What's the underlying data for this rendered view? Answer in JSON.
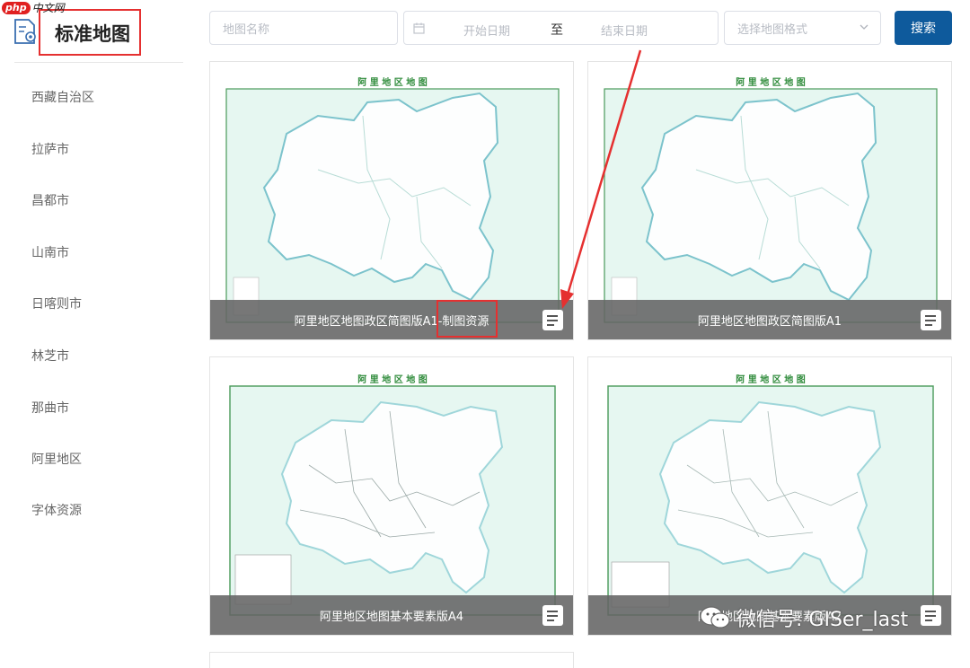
{
  "watermark_top": {
    "badge": "php",
    "text": "中文网"
  },
  "sidebar": {
    "title": "标准地图",
    "items": [
      {
        "label": "西藏自治区"
      },
      {
        "label": "拉萨市"
      },
      {
        "label": "昌都市"
      },
      {
        "label": "山南市"
      },
      {
        "label": "日喀则市"
      },
      {
        "label": "林芝市"
      },
      {
        "label": "那曲市"
      },
      {
        "label": "阿里地区"
      },
      {
        "label": "字体资源"
      }
    ]
  },
  "search": {
    "name_placeholder": "地图名称",
    "start_placeholder": "开始日期",
    "range_separator": "至",
    "end_placeholder": "结束日期",
    "format_placeholder": "选择地图格式",
    "button_label": "搜索"
  },
  "cards": [
    {
      "caption": "阿里地区地图政区简图版A1-制图资源",
      "map_title": "阿 里 地 区 地 图"
    },
    {
      "caption": "阿里地区地图政区简图版A1",
      "map_title": "阿 里 地 区 地 图"
    },
    {
      "caption": "阿里地区地图基本要素版A4",
      "map_title": "阿 里 地 区 地 图"
    },
    {
      "caption": "阿里地区地图基本要素版A2",
      "map_title": "阿 里 地 区 地 图"
    }
  ],
  "watermark_bottom": {
    "text": "微信号: GISer_last"
  },
  "colors": {
    "accent": "#0e5a9c",
    "highlight": "#e53030",
    "map_fill": "#e6f7f1",
    "map_border": "#2e8b3a"
  }
}
